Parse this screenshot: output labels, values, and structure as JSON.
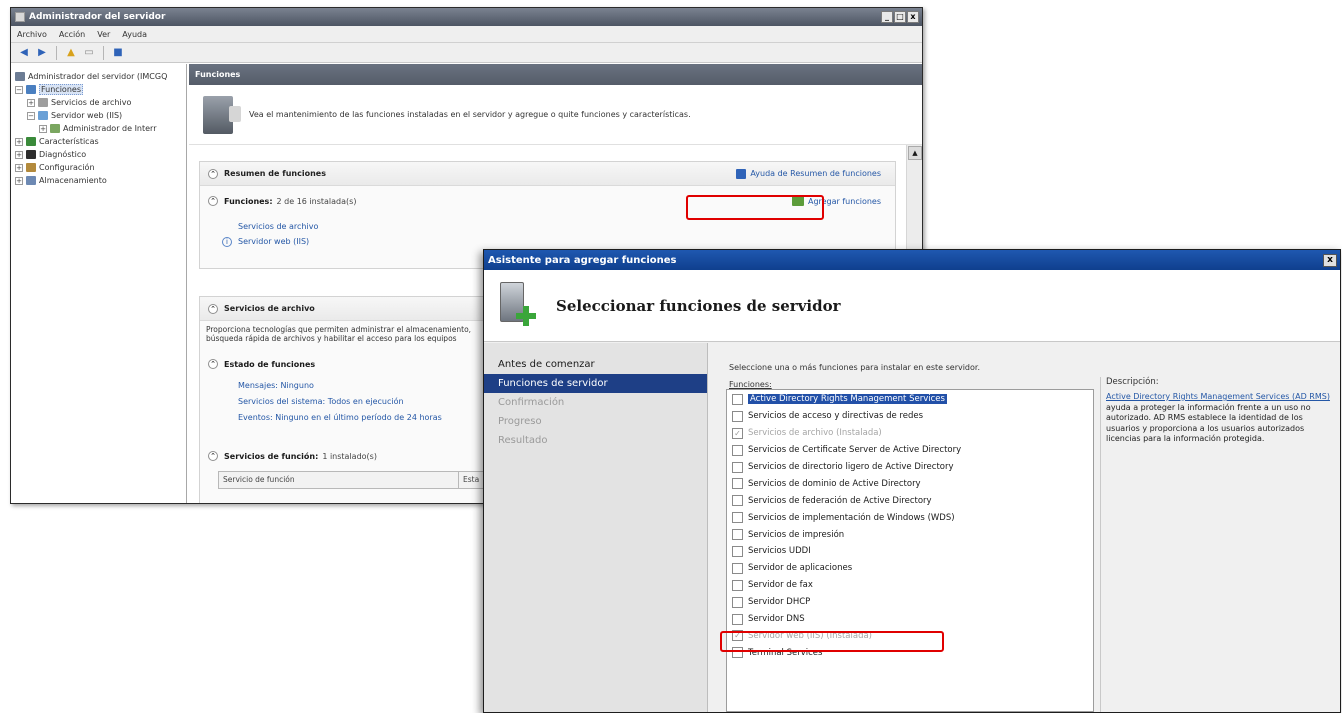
{
  "server_manager": {
    "title": "Administrador del servidor",
    "window_controls": [
      "_",
      "□",
      "x"
    ],
    "menu": [
      "Archivo",
      "Acción",
      "Ver",
      "Ayuda"
    ],
    "tree": [
      {
        "label": "Administrador del servidor (IMCGQ",
        "level": 0,
        "expander": "",
        "icon_color": "#6c7c94"
      },
      {
        "label": "Funciones",
        "level": 0,
        "expander": "−",
        "icon_color": "#4a7fc0",
        "selected": true
      },
      {
        "label": "Servicios de archivo",
        "level": 1,
        "expander": "+",
        "icon_color": "#9e9e9e"
      },
      {
        "label": "Servidor web (IIS)",
        "level": 1,
        "expander": "−",
        "icon_color": "#6aa0d6"
      },
      {
        "label": "Administrador de Interr",
        "level": 2,
        "expander": "+",
        "icon_color": "#7aa660"
      },
      {
        "label": "Características",
        "level": 0,
        "expander": "+",
        "icon_color": "#3a8a3a"
      },
      {
        "label": "Diagnóstico",
        "level": 0,
        "expander": "+",
        "icon_color": "#2d2d2d"
      },
      {
        "label": "Configuración",
        "level": 0,
        "expander": "+",
        "icon_color": "#b38a3c"
      },
      {
        "label": "Almacenamiento",
        "level": 0,
        "expander": "+",
        "icon_color": "#6d89b3"
      }
    ],
    "content_title": "Funciones",
    "intro_text": "Vea el mantenimiento de las funciones instaladas en el servidor y agregue o quite funciones y características.",
    "resumen": {
      "title": "Resumen de funciones",
      "help_link": "Ayuda de Resumen de funciones",
      "funciones_label": "Funciones:",
      "funciones_count": "2 de 16 instalada(s)",
      "add_link": "Agregar funciones",
      "items": [
        "Servicios de archivo",
        "Servidor web (IIS)"
      ]
    },
    "archivo": {
      "title": "Servicios de archivo",
      "desc_line1": "Proporciona tecnologías que permiten administrar el almacenamiento,",
      "desc_line2": "búsqueda rápida de archivos y habilitar el acceso para los equipos",
      "estado_title": "Estado de funciones",
      "estado_items": [
        "Mensajes: Ninguno",
        "Servicios del sistema: Todos en ejecución",
        "Eventos: Ninguno en el último período de 24 horas"
      ],
      "func_label": "Servicios de función:",
      "func_count": "1 instalado(s)",
      "table_col1": "Servicio de función",
      "table_col2": "Esta"
    }
  },
  "wizard": {
    "title": "Asistente para agregar funciones",
    "close": "x",
    "heading": "Seleccionar funciones de servidor",
    "nav": [
      {
        "label": "Antes de comenzar",
        "state": "normal"
      },
      {
        "label": "Funciones de servidor",
        "state": "active"
      },
      {
        "label": "Confirmación",
        "state": "dim"
      },
      {
        "label": "Progreso",
        "state": "dim"
      },
      {
        "label": "Resultado",
        "state": "dim"
      }
    ],
    "instruction": "Seleccione una o más funciones para instalar en este servidor.",
    "roles_label": "Funciones:",
    "roles": [
      {
        "label": "Active Directory Rights Management Services",
        "checked": false,
        "disabled": false,
        "selected": true
      },
      {
        "label": "Servicios de acceso y directivas de redes",
        "checked": false,
        "disabled": false
      },
      {
        "label": "Servicios de archivo (Instalada)",
        "checked": true,
        "disabled": true
      },
      {
        "label": "Servicios de Certificate Server de Active Directory",
        "checked": false,
        "disabled": false
      },
      {
        "label": "Servicios de directorio ligero de Active Directory",
        "checked": false,
        "disabled": false
      },
      {
        "label": "Servicios de dominio de Active Directory",
        "checked": false,
        "disabled": false
      },
      {
        "label": "Servicios de federación de Active Directory",
        "checked": false,
        "disabled": false
      },
      {
        "label": "Servicios de implementación de Windows (WDS)",
        "checked": false,
        "disabled": false
      },
      {
        "label": "Servicios de impresión",
        "checked": false,
        "disabled": false
      },
      {
        "label": "Servicios UDDI",
        "checked": false,
        "disabled": false
      },
      {
        "label": "Servidor de aplicaciones",
        "checked": false,
        "disabled": false
      },
      {
        "label": "Servidor de fax",
        "checked": false,
        "disabled": false
      },
      {
        "label": "Servidor DHCP",
        "checked": false,
        "disabled": false
      },
      {
        "label": "Servidor DNS",
        "checked": false,
        "disabled": false
      },
      {
        "label": "Servidor web (IIS) (Instalada)",
        "checked": true,
        "disabled": true
      },
      {
        "label": "Terminal Services",
        "checked": false,
        "disabled": false
      }
    ],
    "description": {
      "title": "Descripción:",
      "link_text": "Active Directory Rights Management Services (AD RMS)",
      "text": "ayuda a proteger la información frente a un uso no autorizado. AD RMS establece la identidad de los usuarios y proporciona a los usuarios autorizados licencias para la información protegida."
    }
  },
  "colors": {
    "highlight_red": "#e00000",
    "wizard_titlebar": "#1f58b0",
    "nav_active": "#1e3f86",
    "link_blue": "#2457a6"
  }
}
